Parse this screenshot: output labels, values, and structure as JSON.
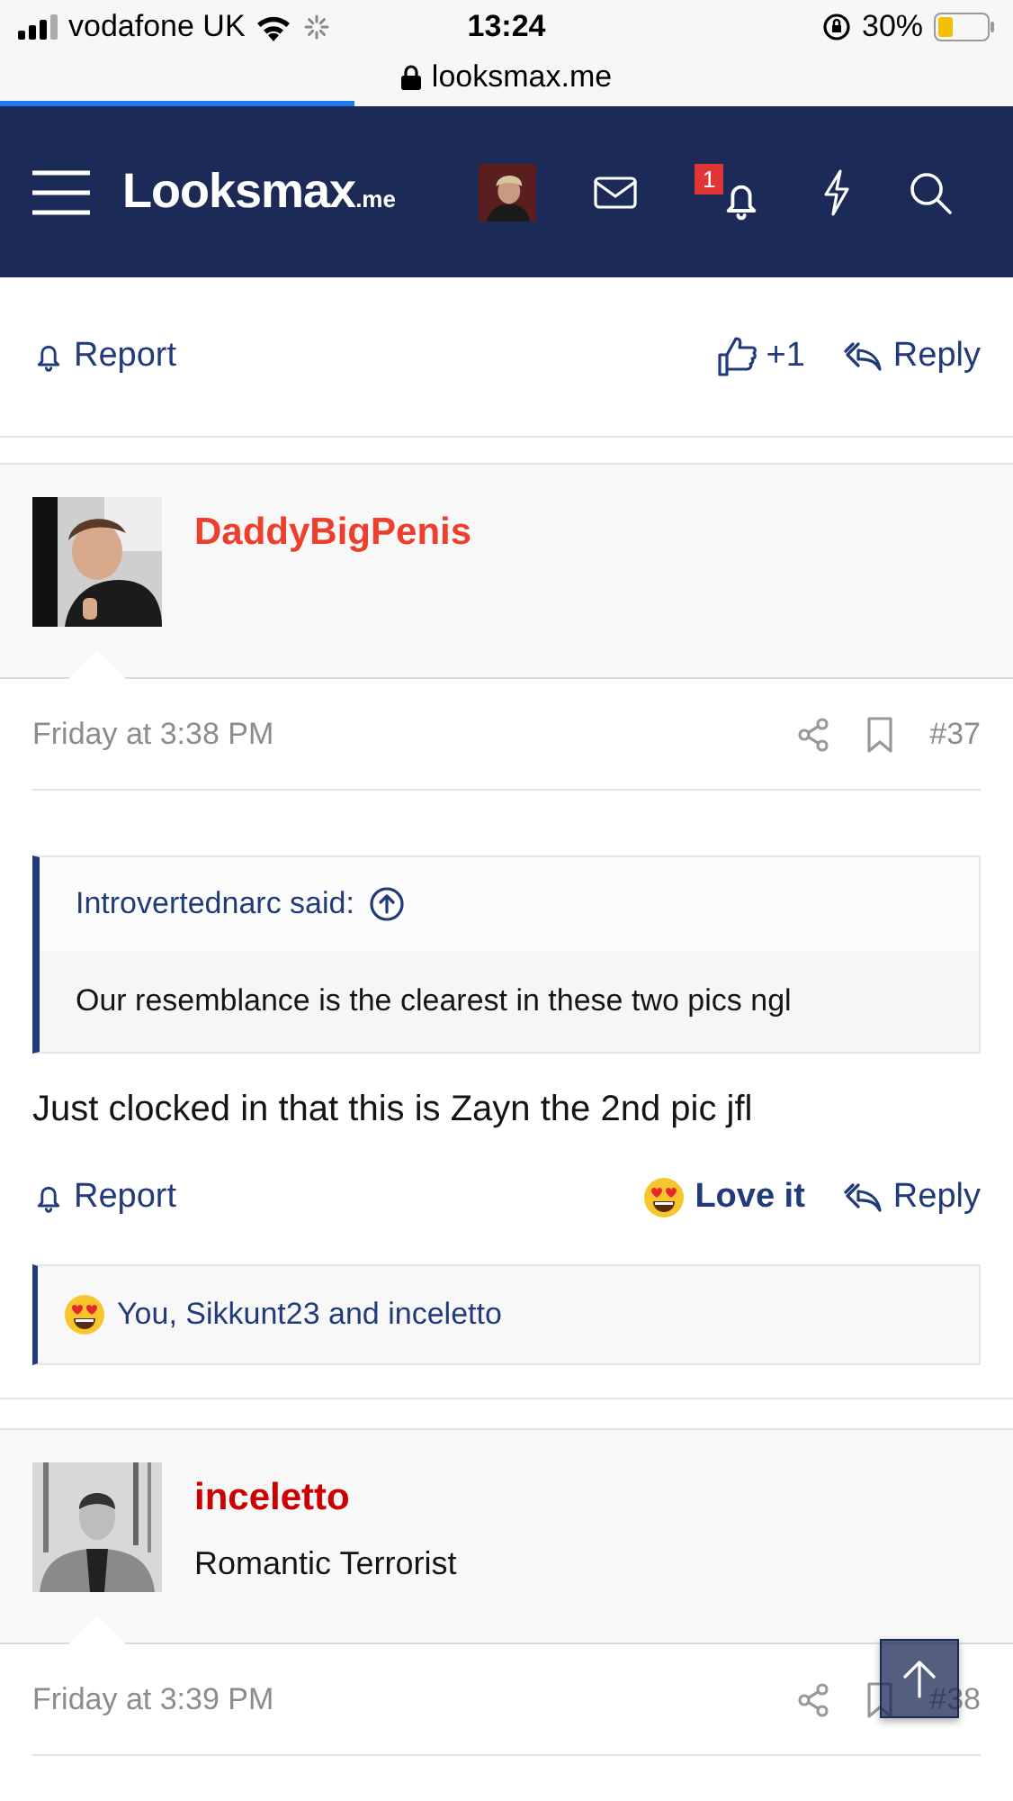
{
  "status_bar": {
    "carrier": "vodafone UK",
    "time": "13:24",
    "battery": "30%"
  },
  "browser": {
    "url": "looksmax.me",
    "load_progress": {
      "level": 0.35
    }
  },
  "nav": {
    "logo": "Looksmax",
    "logo_suffix": ".me",
    "notification_count": "1"
  },
  "prev_post_actions": {
    "report": "Report",
    "like": "+1",
    "reply": "Reply"
  },
  "posts": [
    {
      "author": "DaddyBigPenis",
      "color": "#ee3f2d",
      "date": "Friday at 3:38 PM",
      "number": "#37",
      "quote": {
        "author": "Introvertednarc said:",
        "text": "Our resemblance is the clearest in these two pics ngl"
      },
      "body": "Just clocked in that this is Zayn the 2nd pic jfl",
      "actions": {
        "report": "Report",
        "reaction": "Love it",
        "reply": "Reply"
      },
      "reactions": "You, Sikkunt23 and inceletto"
    },
    {
      "author": "inceletto",
      "color": "#cc0000",
      "user_title": "Romantic Terrorist",
      "date": "Friday at 3:39 PM",
      "number": "#38"
    }
  ]
}
